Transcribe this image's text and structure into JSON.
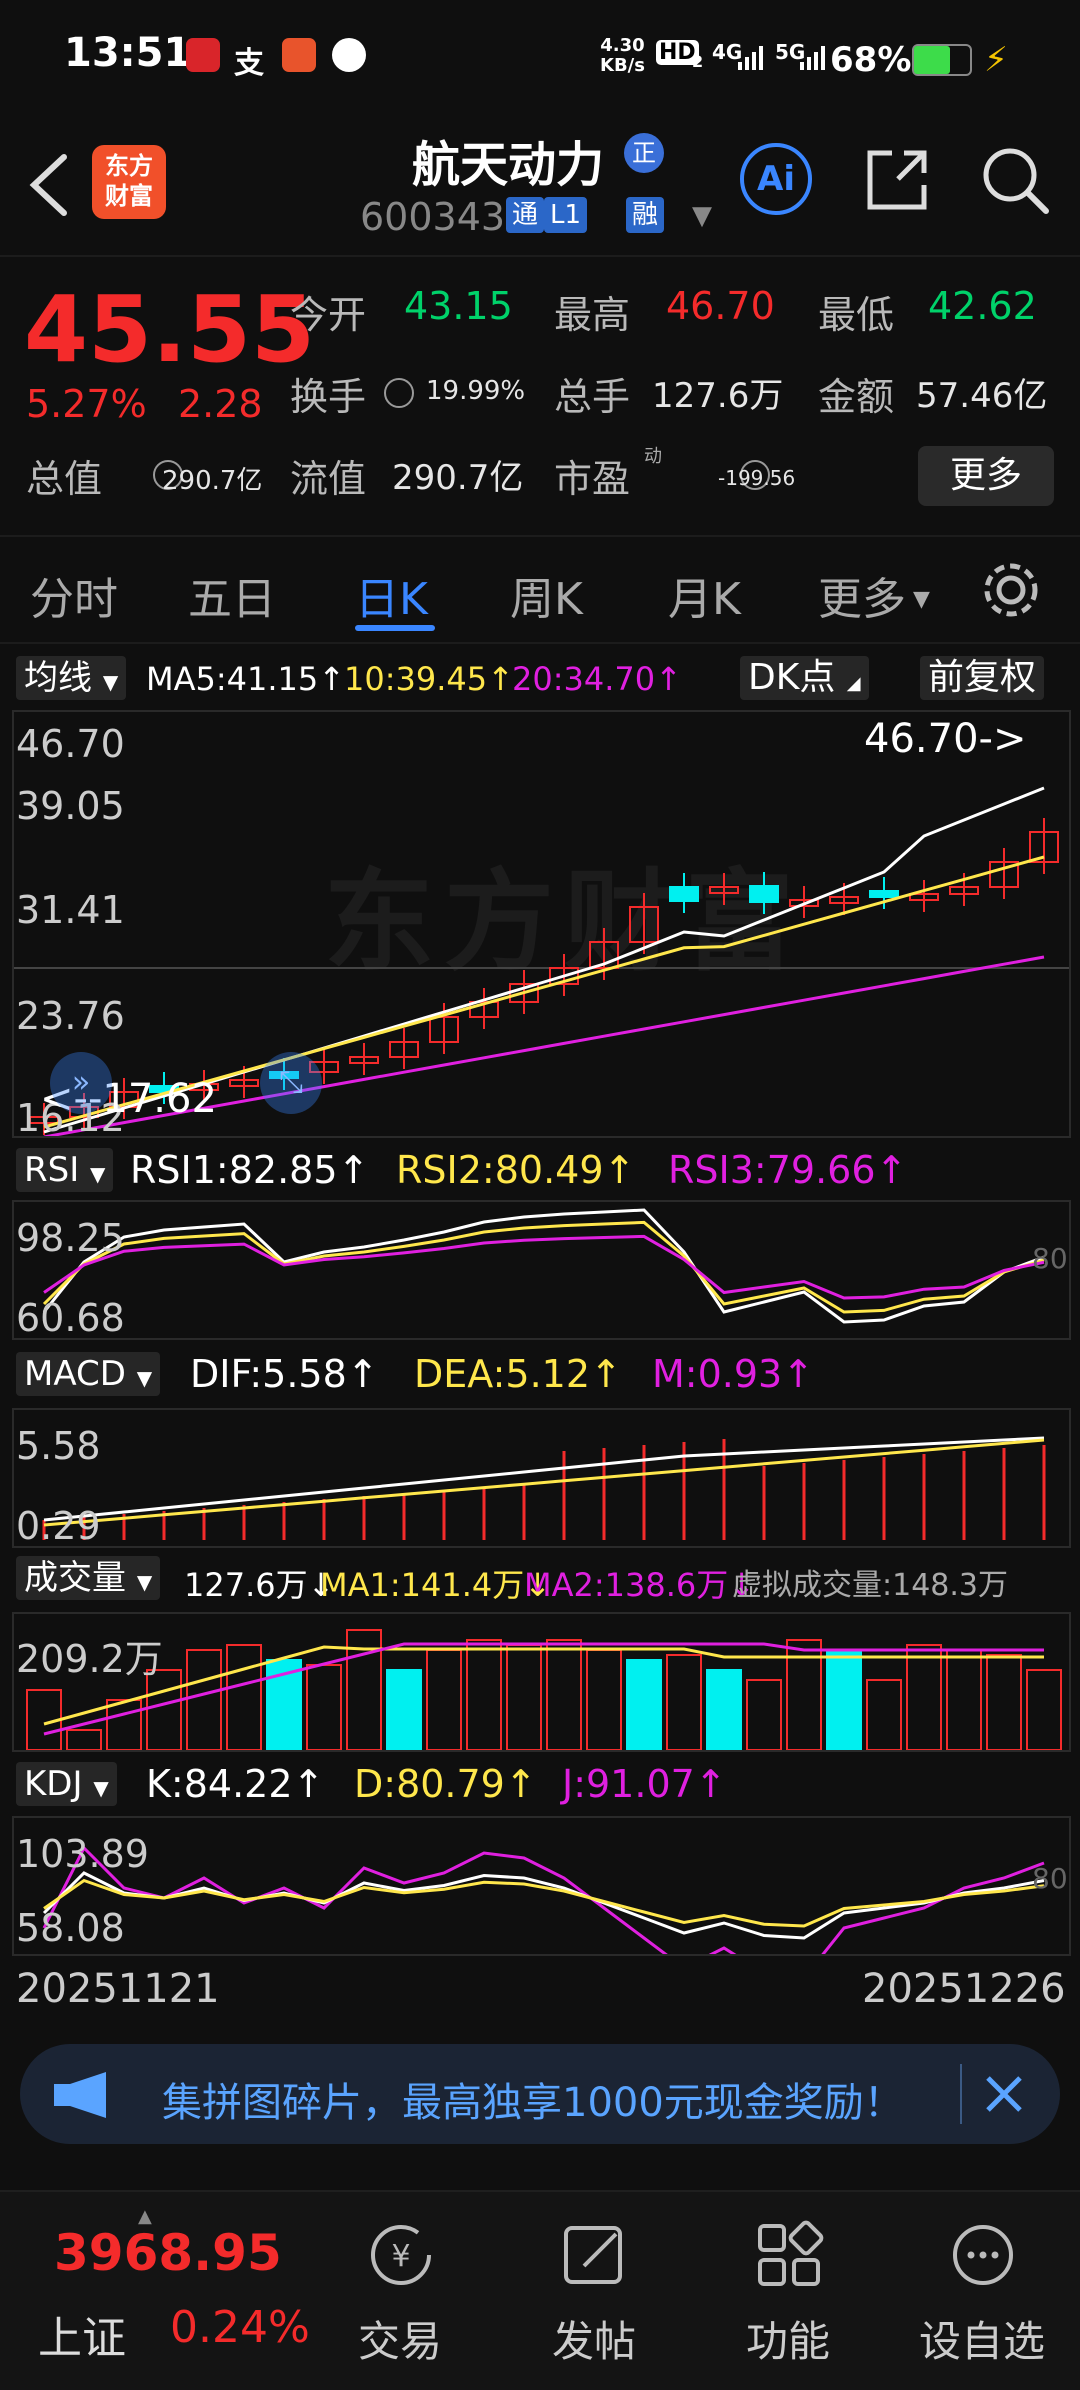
{
  "status": {
    "time": "13:51",
    "net_speed_top": "4.30",
    "net_speed_bottom": "KB/s",
    "hd": "HD",
    "hd_sub": "2",
    "net1": "4G",
    "net2": "5G",
    "battery": "68%"
  },
  "header": {
    "app_logo_line1": "东方",
    "app_logo_line2": "财富",
    "title": "航天动力",
    "title_badge": "正",
    "code": "600343",
    "tags": [
      "通",
      "L1",
      "融"
    ],
    "ai_label": "Ai"
  },
  "quote": {
    "price": "45.55",
    "change_pct": "5.27%",
    "change_amt": "2.28",
    "open_label": "今开",
    "open": "43.15",
    "high_label": "最高",
    "high": "46.70",
    "low_label": "最低",
    "low": "42.62",
    "turnover_label": "换手",
    "turnover": "19.99%",
    "volume_label": "总手",
    "volume": "127.6万",
    "amount_label": "金额",
    "amount": "57.46亿",
    "total_mv_label": "总值",
    "total_mv": "290.7亿",
    "float_mv_label": "流值",
    "float_mv": "290.7亿",
    "pe_label": "市盈",
    "pe_sup": "动",
    "pe": "-199.56",
    "more_button": "更多"
  },
  "tabs": [
    "分时",
    "五日",
    "日K",
    "周K",
    "月K",
    "更多"
  ],
  "active_tab": 2,
  "kline": {
    "selector": "均线",
    "ma5": "MA5:41.15↑",
    "ma10": "10:39.45↑",
    "ma20": "20:34.70↑",
    "dk_button": "DK点",
    "adjust_button": "前复权",
    "y_ticks": [
      "46.70",
      "39.05",
      "31.41",
      "23.76",
      "16.12"
    ],
    "high_marker": "46.70->",
    "low_marker": "<--17.62",
    "watermark": "东方财富"
  },
  "rsi": {
    "selector": "RSI",
    "rsi1": "RSI1:82.85↑",
    "rsi2": "RSI2:80.49↑",
    "rsi3": "RSI3:79.66↑",
    "y_ticks": [
      "98.25",
      "60.68"
    ],
    "right_ref": "80"
  },
  "macd": {
    "selector": "MACD",
    "dif": "DIF:5.58↑",
    "dea": "DEA:5.12↑",
    "m": "M:0.93↑",
    "y_ticks": [
      "5.58",
      "0.29"
    ]
  },
  "volume": {
    "selector": "成交量",
    "vol": "127.6万↓",
    "ma1": "MA1:141.4万↓",
    "ma2": "MA2:138.6万↓",
    "virtual": "虚拟成交量:148.3万",
    "y_tick": "209.2万"
  },
  "kdj": {
    "selector": "KDJ",
    "k": "K:84.22↑",
    "d": "D:80.79↑",
    "j": "J:91.07↑",
    "y_ticks": [
      "103.89",
      "58.08"
    ],
    "right_ref": "80"
  },
  "dates": {
    "start": "20251121",
    "end": "20251226"
  },
  "notice": {
    "text": "集拼图碎片，最高独享1000元现金奖励！"
  },
  "bottom": {
    "index_value": "3968.95",
    "index_name": "上证",
    "index_change": "0.24%",
    "nav": [
      "交易",
      "发帖",
      "功能",
      "设自选"
    ]
  },
  "colors": {
    "up": "#f42b2b",
    "down": "#00d26a",
    "ma5": "#ffffff",
    "ma10": "#ffe74c",
    "ma20": "#e020e0",
    "cyan": "#00f0f0",
    "accent": "#3a86ff"
  },
  "icons": [
    "back-arrow-icon",
    "ai-icon",
    "share-icon",
    "search-icon",
    "gear-icon",
    "megaphone-icon",
    "close-icon",
    "trade-icon",
    "post-icon",
    "function-icon",
    "watchlist-icon"
  ]
}
